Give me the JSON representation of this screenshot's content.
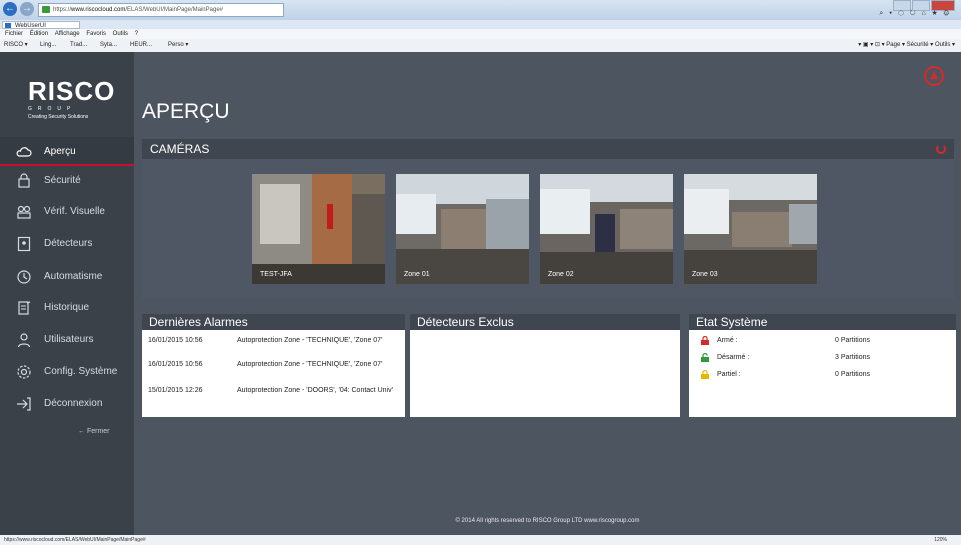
{
  "browser": {
    "url_prefix": "https://",
    "url_host": "www.riscocloud.com",
    "url_path": "/ELAS/WebUI/MainPage/MainPage#",
    "tab_title": "WebUserUI",
    "menu": [
      "Fichier",
      "Édition",
      "Affichage",
      "Favoris",
      "Outils",
      "?"
    ],
    "favorites": [
      "RISCO ▾",
      "Ling...",
      "Trad...",
      "Syta...",
      "HEUR...",
      "Perso ▾"
    ],
    "commands": "▾ ▣ ▾ ⊡ ▾ Page ▾ Sécurité ▾ Outils ▾",
    "status_url": "https://www.riscocloud.com/ELAS/WebUI/MainPage/MainPage#",
    "zoom": "120%"
  },
  "app": {
    "logo_text": "RISCO",
    "logo_group": "GROUP",
    "logo_tagline": "Creating Security Solutions",
    "page_title": "APERÇU",
    "sidebar": [
      {
        "label": "Aperçu",
        "icon": "cloud-icon"
      },
      {
        "label": "Sécurité",
        "icon": "shield-icon"
      },
      {
        "label": "Vérif. Visuelle",
        "icon": "camera-icon"
      },
      {
        "label": "Détecteurs",
        "icon": "detector-icon"
      },
      {
        "label": "Automatisme",
        "icon": "clock-icon"
      },
      {
        "label": "Historique",
        "icon": "history-icon"
      },
      {
        "label": "Utilisateurs",
        "icon": "user-icon"
      },
      {
        "label": "Config. Système",
        "icon": "gear-icon"
      },
      {
        "label": "Déconnexion",
        "icon": "logout-icon"
      }
    ],
    "sidebar_close": "← Fermer",
    "cameras_title": "CAMÉRAS",
    "cameras": [
      "TEST-JFA",
      "Zone 01",
      "Zone 02",
      "Zone 03"
    ],
    "alarms_title": "Dernières Alarmes",
    "alarms": [
      {
        "date": "16/01/2015 10:56",
        "text": "Autoprotection Zone - 'TECHNIQUE', 'Zone 07'"
      },
      {
        "date": "16/01/2015 10:56",
        "text": "Autoprotection Zone - 'TECHNIQUE', 'Zone 07'"
      },
      {
        "date": "15/01/2015 12:26",
        "text": "Autoprotection Zone - 'DOORS', '04: Contact Univ'"
      }
    ],
    "excluded_title": "Détecteurs Exclus",
    "system_title": "Etat Système",
    "system": [
      {
        "state": "Armé :",
        "count": "0 Partitions",
        "color": "#d42a2a"
      },
      {
        "state": "Désarmé :",
        "count": "3 Partitions",
        "color": "#2e9a3a"
      },
      {
        "state": "Partiel :",
        "count": "0 Partitions",
        "color": "#e6b800"
      }
    ],
    "footer": "© 2014 All rights reserved to RISCO Group LTD   www.riscogroup.com"
  },
  "colors": {
    "accent": "#c8102e",
    "sidebar": "#3b4149",
    "content": "#4d5560"
  }
}
